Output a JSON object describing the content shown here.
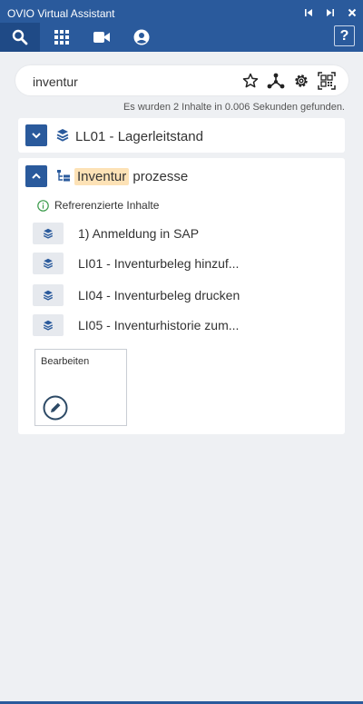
{
  "app": {
    "title": "OVIO Virtual Assistant"
  },
  "window_controls": [
    "first-icon",
    "last-icon",
    "close-icon"
  ],
  "toolbar": {
    "buttons": [
      {
        "name": "search-icon",
        "active": true
      },
      {
        "name": "grid-icon",
        "active": false
      },
      {
        "name": "video-icon",
        "active": false
      },
      {
        "name": "user-icon",
        "active": false
      }
    ],
    "help_label": "?"
  },
  "search": {
    "value": "inventur",
    "icons": [
      "star-icon",
      "network-icon",
      "gear-icon",
      "qr-code-icon"
    ],
    "result_info": "Es wurden 2 Inhalte in 0.006 Sekunden gefunden."
  },
  "results": [
    {
      "title": "LL01 - Lagerleitstand",
      "expanded": false
    },
    {
      "title_highlight": "Inventur",
      "title_rest": " prozesse",
      "expanded": true,
      "referenced_label": "Refrerenzierte Inhalte",
      "items": [
        "1) Anmeldung in SAP",
        "LI01 - Inventurbeleg hinzuf...",
        "LI04 - Inventurbeleg drucken",
        "LI05 - Inventurhistorie zum..."
      ],
      "edit_label": "Bearbeiten"
    }
  ],
  "colors": {
    "accent": "#2a5a9c",
    "highlight": "#fde2b6",
    "background": "#eef0f3"
  }
}
